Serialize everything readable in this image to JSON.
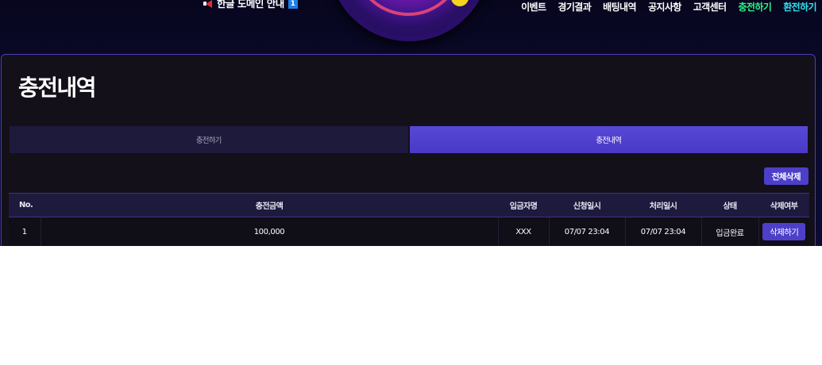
{
  "header": {
    "notice_text": "한글 도메인 안내",
    "notice_badge": "1",
    "nav": [
      {
        "label": "이벤트"
      },
      {
        "label": "경기결과"
      },
      {
        "label": "배팅내역"
      },
      {
        "label": "공지사항"
      },
      {
        "label": "고객센터"
      },
      {
        "label": "충전하기"
      },
      {
        "label": "환전하기"
      }
    ]
  },
  "page": {
    "title": "충전내역",
    "tabs": [
      {
        "label": "충전하기",
        "active": false
      },
      {
        "label": "충전내역",
        "active": true
      }
    ],
    "delete_all_label": "전체삭제"
  },
  "table": {
    "columns": [
      "No.",
      "충전금액",
      "입금자명",
      "신청일시",
      "처리일시",
      "상태",
      "삭제여부"
    ],
    "rows": [
      {
        "no": "1",
        "amount": "100,000",
        "depositor": "XXX",
        "requested": "07/07 23:04",
        "processed": "07/07 23:04",
        "status": "입금완료",
        "delete_label": "삭제하기"
      }
    ]
  },
  "colors": {
    "accent": "#4d3fc9",
    "charge_link": "#2ef58a",
    "exchange_link": "#33e3f2",
    "panel_border": "#4d3eb4"
  }
}
